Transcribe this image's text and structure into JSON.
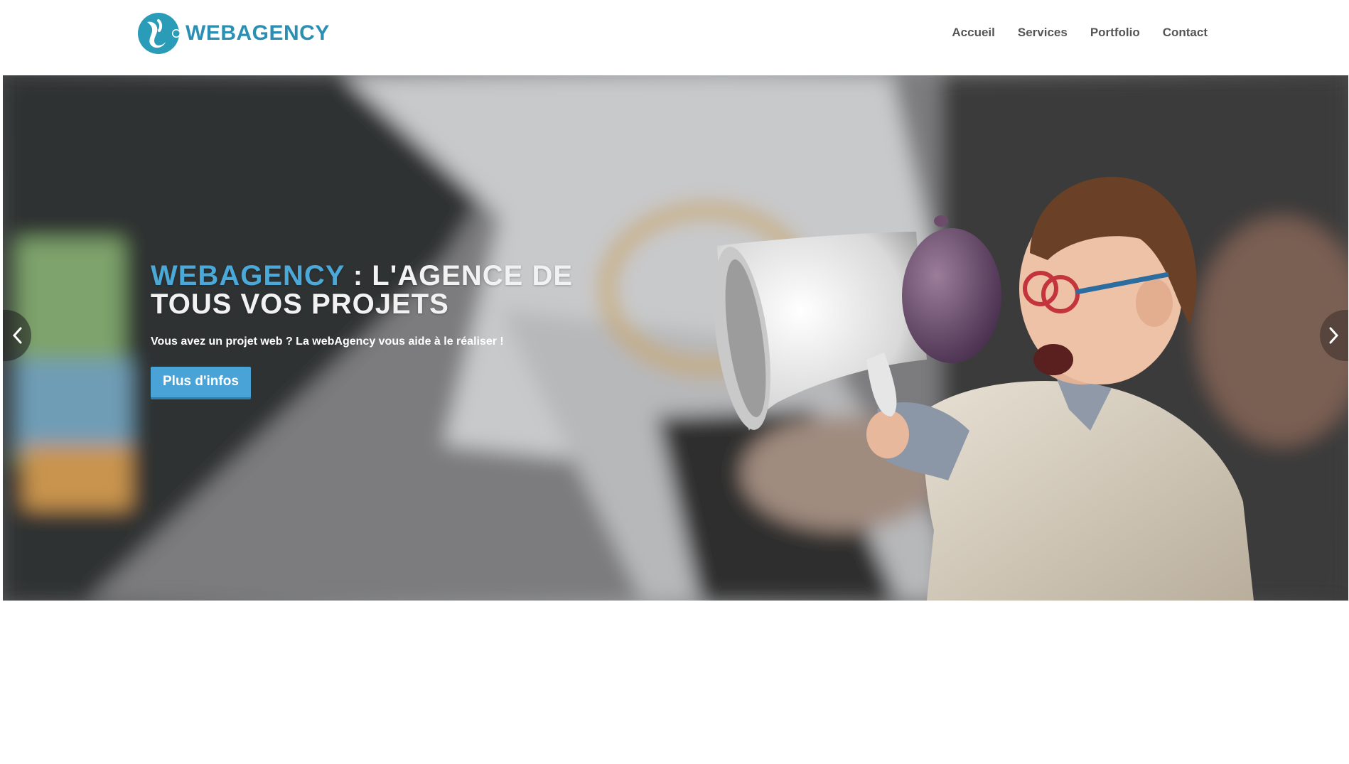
{
  "header": {
    "logo_text": "WEBAGENCY",
    "nav": [
      {
        "label": "Accueil"
      },
      {
        "label": "Services"
      },
      {
        "label": "Portfolio"
      },
      {
        "label": "Contact"
      }
    ]
  },
  "hero": {
    "title_brand": "WEBAGENCY",
    "title_rest": " : L'AGENCE DE TOUS VOS PROJETS",
    "subtitle": "Vous avez un projet web ? La webAgency vous aide à le réaliser !",
    "button_label": "Plus d'infos"
  },
  "colors": {
    "brand": "#2b8fb3",
    "accent": "#4aa9d8",
    "button": "#4aa3d6",
    "nav_text": "#555555"
  },
  "icons": {
    "prev": "chevron-left-icon",
    "next": "chevron-right-icon",
    "logo": "logo-icon"
  }
}
